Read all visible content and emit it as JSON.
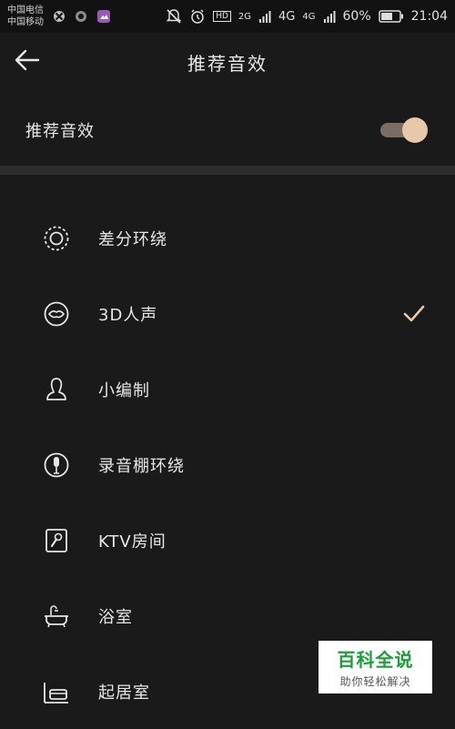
{
  "status_bar": {
    "carrier_1": "中国电信",
    "carrier_2": "中国移动",
    "network_1": "2G",
    "network_2": "4G",
    "network_3": "4G",
    "hd": "HD",
    "battery": "60%",
    "time": "21:04"
  },
  "app_bar": {
    "title": "推荐音效"
  },
  "toggle": {
    "label": "推荐音效",
    "on": true
  },
  "items": [
    {
      "label": "差分环绕",
      "icon": "surround-icon",
      "selected": false
    },
    {
      "label": "3D人声",
      "icon": "lips-icon",
      "selected": true
    },
    {
      "label": "小编制",
      "icon": "person-bust-icon",
      "selected": false
    },
    {
      "label": "录音棚环绕",
      "icon": "microphone-icon",
      "selected": false
    },
    {
      "label": "KTV房间",
      "icon": "ktv-mic-icon",
      "selected": false
    },
    {
      "label": "浴室",
      "icon": "bathtub-icon",
      "selected": false
    },
    {
      "label": "起居室",
      "icon": "sofa-icon",
      "selected": false
    }
  ],
  "watermark": {
    "main": "百科全说",
    "sub": "助你轻松解决"
  },
  "colors": {
    "accent": "#e7c8a8",
    "background": "#1a1a1a",
    "watermark_green": "#1a9f3a"
  }
}
